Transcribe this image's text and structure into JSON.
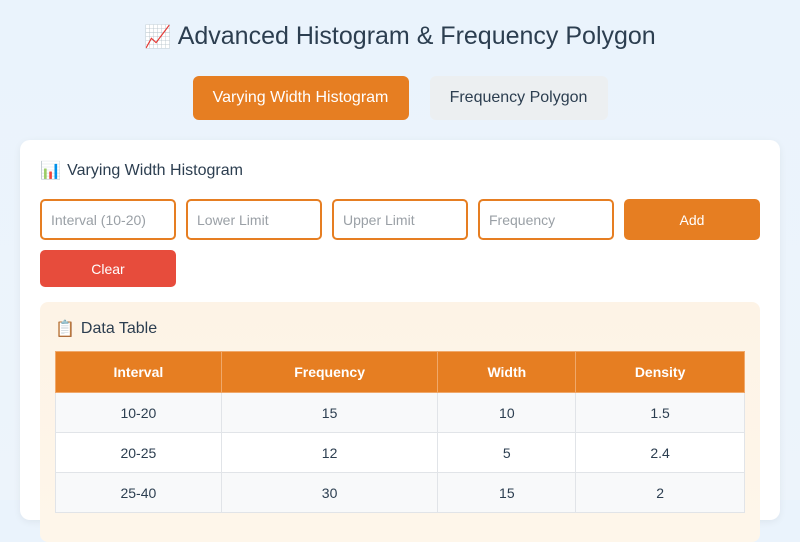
{
  "header": {
    "title_icon": "chart-increasing-icon",
    "title_glyph": "📈",
    "title": "Advanced Histogram & Frequency Polygon"
  },
  "tabs": [
    {
      "label": "Varying Width Histogram",
      "active": true
    },
    {
      "label": "Frequency Polygon",
      "active": false
    }
  ],
  "panel": {
    "icon": "bar-chart-icon",
    "icon_glyph": "📊",
    "title": "Varying Width Histogram",
    "inputs": {
      "interval": {
        "placeholder": "Interval (10-20)",
        "value": ""
      },
      "lower": {
        "placeholder": "Lower Limit",
        "value": ""
      },
      "upper": {
        "placeholder": "Upper Limit",
        "value": ""
      },
      "frequency": {
        "placeholder": "Frequency",
        "value": ""
      }
    },
    "add_label": "Add",
    "clear_label": "Clear"
  },
  "data_table": {
    "icon": "clipboard-icon",
    "icon_glyph": "📋",
    "title": "Data Table",
    "columns": [
      "Interval",
      "Frequency",
      "Width",
      "Density"
    ],
    "rows": [
      [
        "10-20",
        "15",
        "10",
        "1.5"
      ],
      [
        "20-25",
        "12",
        "5",
        "2.4"
      ],
      [
        "25-40",
        "30",
        "15",
        "2"
      ]
    ]
  },
  "colors": {
    "accent": "#e67e22",
    "danger": "#e74c3c",
    "text": "#2c3e50"
  }
}
